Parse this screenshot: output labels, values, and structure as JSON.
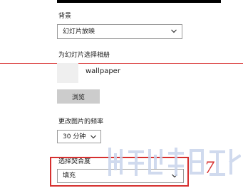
{
  "background": {
    "label": "背景",
    "selected": "幻灯片放映"
  },
  "album": {
    "label": "为幻灯片选择相册",
    "name": "wallpaper",
    "browse_label": "浏览"
  },
  "frequency": {
    "label": "更改图片的频率",
    "selected": "30 分钟"
  },
  "fit": {
    "label": "选择契合度",
    "selected": "填充"
  },
  "annotation": {
    "step": "7"
  },
  "colors": {
    "highlight": "#d6302f",
    "guide_line": "#e05a5a",
    "button_bg": "#cccccc",
    "watermark": "#c8d4ec"
  },
  "icons": {
    "dropdown": "chevron-down-icon",
    "watermark": "watermark-logo"
  }
}
